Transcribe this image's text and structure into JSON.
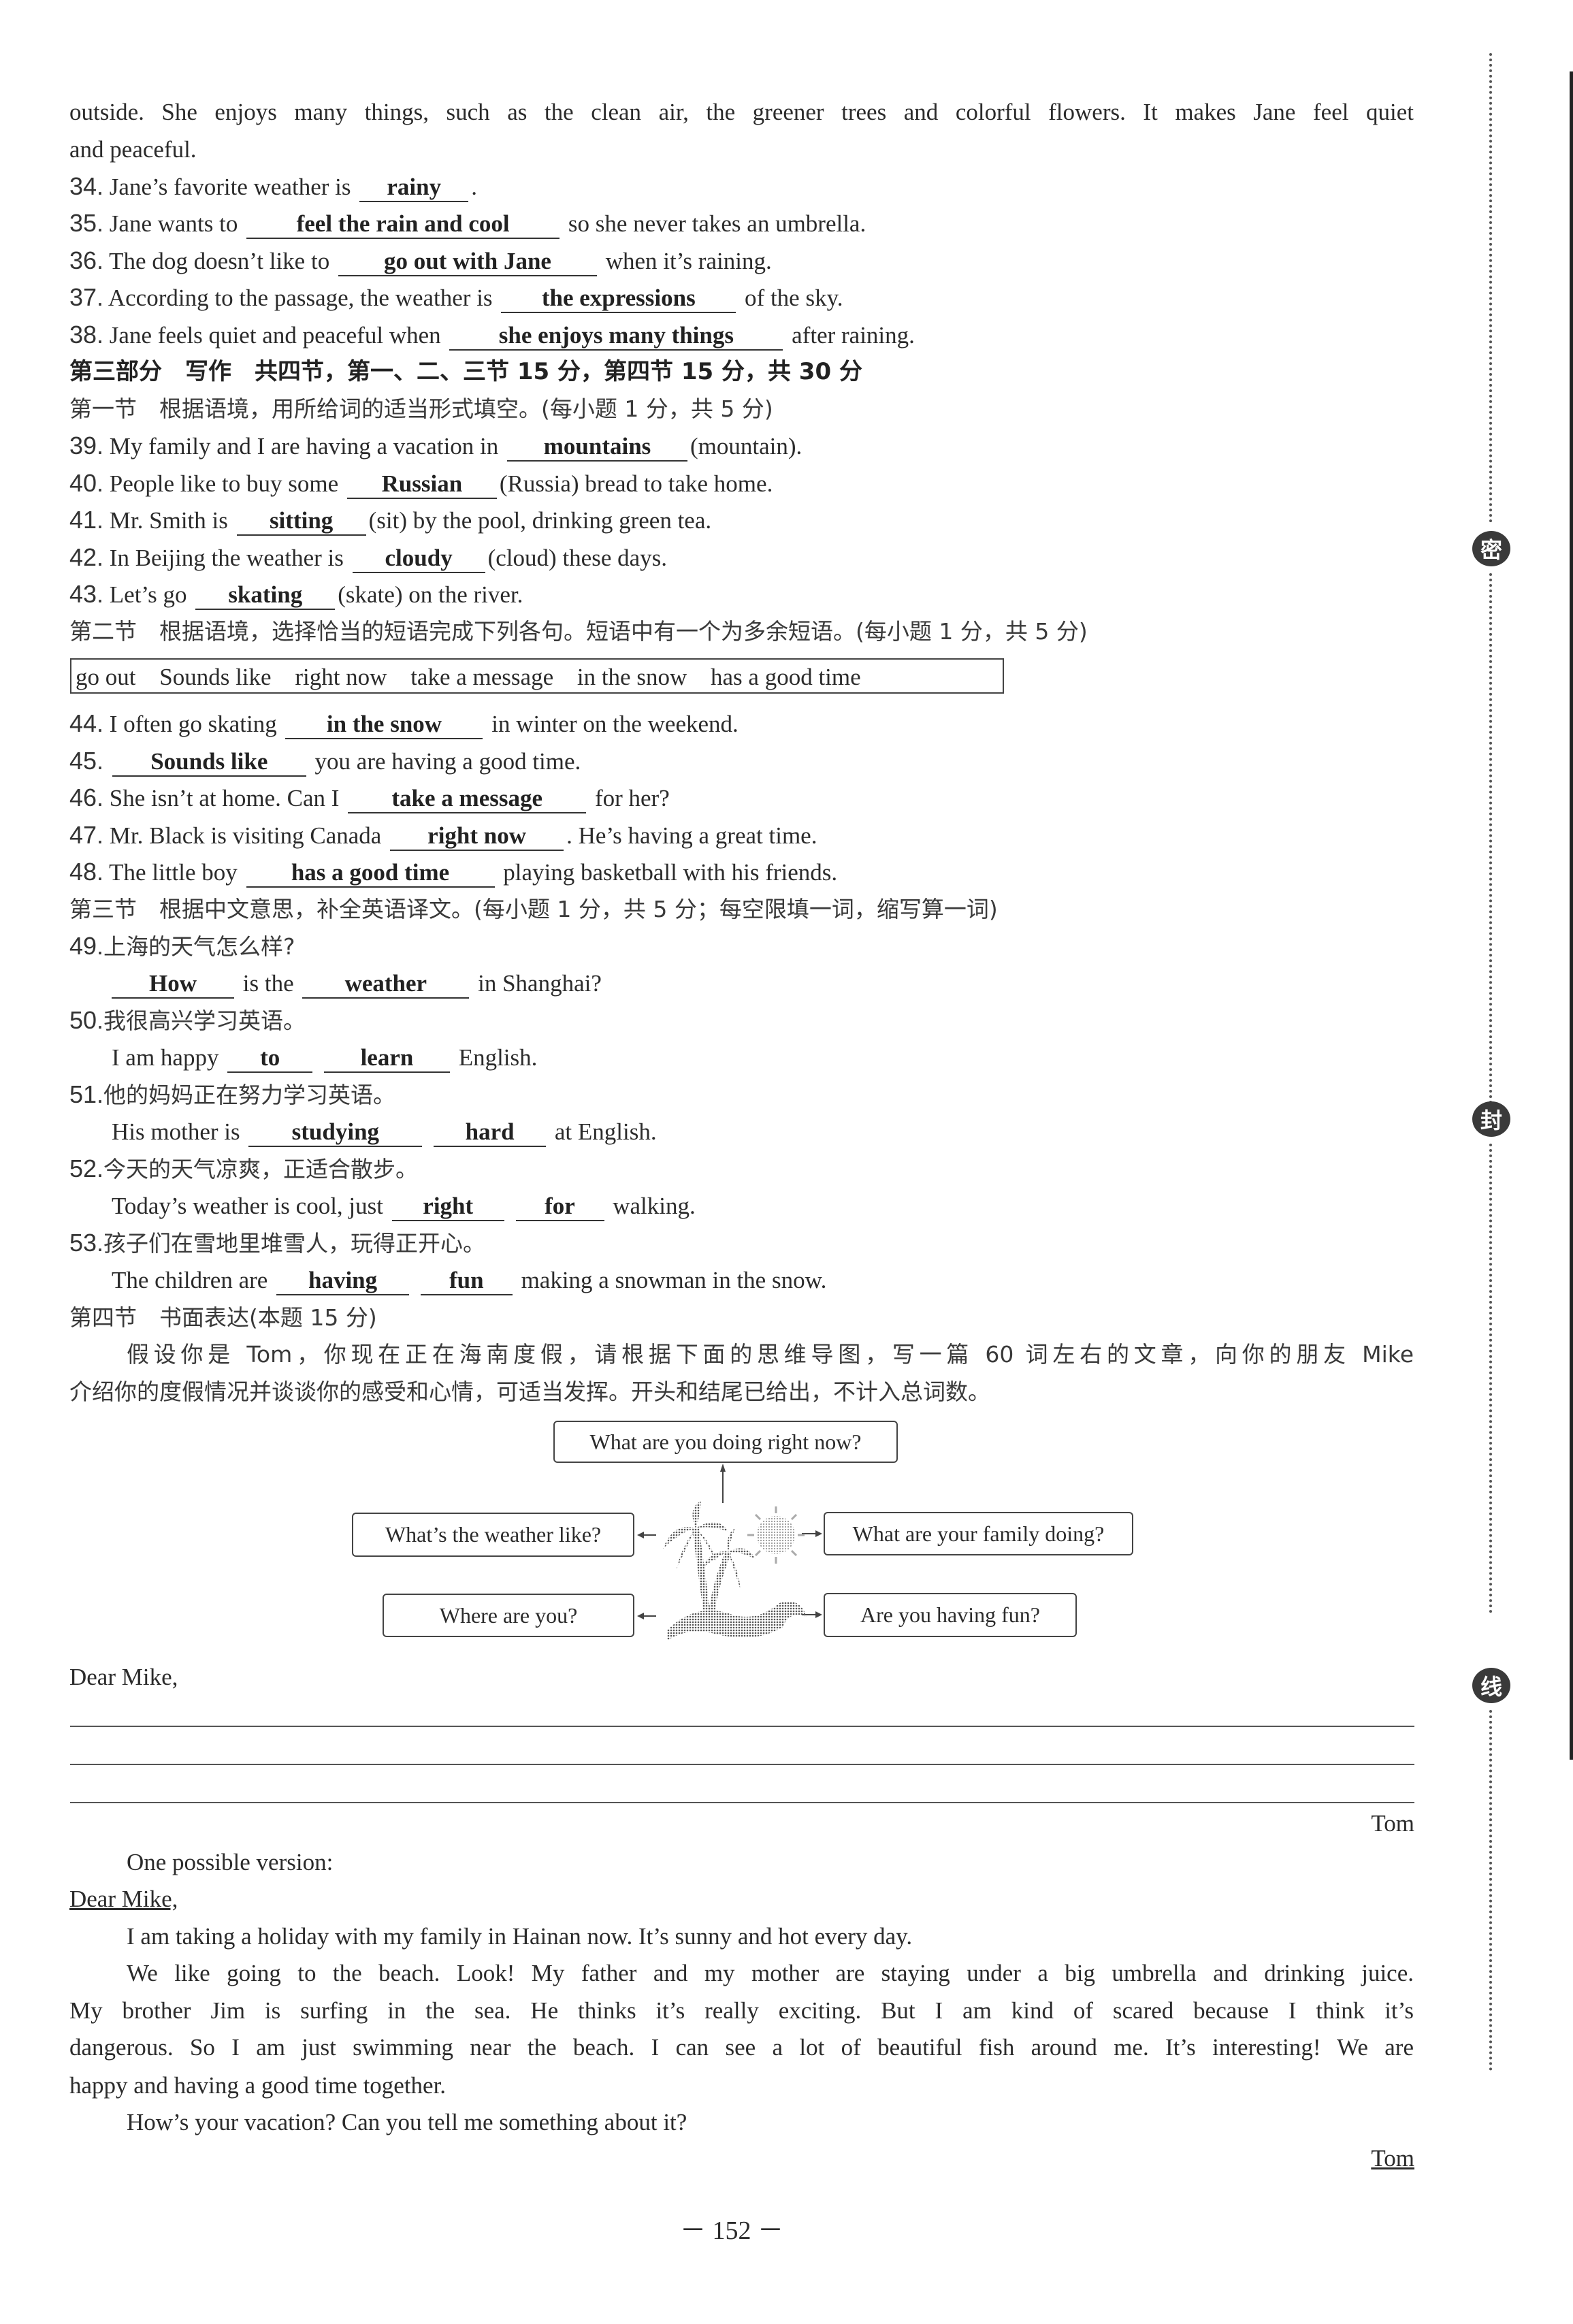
{
  "reading_tail": {
    "line1": "outside. She enjoys many things, such as the clean air, the greener trees and colorful flowers. It makes Jane feel quiet",
    "line2": "and peaceful."
  },
  "part1_answers": [
    {
      "num": "34.",
      "before": "Jane’s favorite weather is",
      "answer": "rainy",
      "after": "."
    },
    {
      "num": "35.",
      "before": "Jane wants to",
      "answer": "feel the rain and cool",
      "after": "so she never takes an umbrella."
    },
    {
      "num": "36.",
      "before": "The dog doesn’t like to",
      "answer": "go out with Jane",
      "after": "when it’s raining."
    },
    {
      "num": "37.",
      "before": "According to the passage, the weather is",
      "answer": "the expressions",
      "after": "of the sky."
    },
    {
      "num": "38.",
      "before": "Jane feels quiet and peaceful when",
      "answer": "she enjoys many things",
      "after": "after raining."
    }
  ],
  "part3_heading": "第三部分　写作　共四节，第一、二、三节 15 分，第四节 15 分，共 30 分",
  "section1": {
    "heading": "第一节　根据语境，用所给词的适当形式填空。(每小题 1 分，共 5 分)",
    "items": [
      {
        "num": "39.",
        "before": "My family and I are having a vacation in",
        "answer": "mountains",
        "after": "(mountain)."
      },
      {
        "num": "40.",
        "before": "People like to buy some",
        "answer": "Russian",
        "after": "(Russia) bread to take home."
      },
      {
        "num": "41.",
        "before": "Mr. Smith is",
        "answer": "sitting",
        "after": "(sit) by the pool, drinking green tea."
      },
      {
        "num": "42.",
        "before": "In Beijing the weather is",
        "answer": "cloudy",
        "after": "(cloud) these days."
      },
      {
        "num": "43.",
        "before": "Let’s go",
        "answer": "skating",
        "after": "(skate) on the river."
      }
    ]
  },
  "section2": {
    "heading": "第二节　根据语境，选择恰当的短语完成下列各句。短语中有一个为多余短语。(每小题 1 分，共 5 分)",
    "phrases": [
      "go out",
      "Sounds like",
      "right now",
      "take a message",
      "in the snow",
      "has a good time"
    ],
    "items": [
      {
        "num": "44.",
        "before": "I often go skating",
        "answer": "in the snow",
        "after": "in winter on the weekend."
      },
      {
        "num": "45.",
        "before": "",
        "answer": "Sounds like",
        "after": "you are having a good time."
      },
      {
        "num": "46.",
        "before": "She isn’t at home. Can I",
        "answer": "take a message",
        "after": "for her?"
      },
      {
        "num": "47.",
        "before": "Mr. Black is visiting Canada",
        "answer": "right now",
        "after": ". He’s having a great time."
      },
      {
        "num": "48.",
        "before": "The little boy",
        "answer": "has a good time",
        "after": "playing basketball with his friends."
      }
    ]
  },
  "section3": {
    "heading": "第三节　根据中文意思，补全英语译文。(每小题 1 分，共 5 分；每空限填一词，缩写算一词)",
    "items": [
      {
        "num": "49.",
        "chinese": "上海的天气怎么样?",
        "parts": [
          "",
          "How",
          "is the",
          "weather",
          "in Shanghai?"
        ]
      },
      {
        "num": "50.",
        "chinese": "我很高兴学习英语。",
        "parts": [
          "I am happy",
          "to",
          "",
          "learn",
          "English."
        ]
      },
      {
        "num": "51.",
        "chinese": "他的妈妈正在努力学习英语。",
        "parts": [
          "His mother is",
          "studying",
          "",
          "hard",
          "at English."
        ]
      },
      {
        "num": "52.",
        "chinese": "今天的天气凉爽，正适合散步。",
        "parts": [
          "Today’s weather is cool, just",
          "right",
          "",
          "for",
          "walking."
        ]
      },
      {
        "num": "53.",
        "chinese": "孩子们在雪地里堆雪人，玩得正开心。",
        "parts": [
          "The children are",
          "having",
          "",
          "fun",
          "making a snowman in the snow."
        ]
      }
    ]
  },
  "section4": {
    "heading": "第四节　书面表达(本题 15 分)",
    "prompt_line1": "假设你是 Tom，你现在正在海南度假，请根据下面的思维导图，写一篇 60 词左右的文章，向你的朋友 Mike",
    "prompt_line2": "介绍你的度假情况并谈谈你的感受和心情，可适当发挥。开头和结尾已给出，不计入总词数。",
    "mind_map": {
      "top": "What are you doing right now?",
      "left_top": "What’s the weather like?",
      "left_bottom": "Where are you?",
      "right_top": "What are your family doing?",
      "right_bottom": "Are you having fun?"
    },
    "greeting": "Dear Mike,",
    "signature": "Tom"
  },
  "sample": {
    "label": "One possible version:",
    "greeting": "Dear Mike,",
    "p1": "I am taking a holiday with my family in Hainan now. It’s sunny and hot every day.",
    "p2_line1": "We like going to the beach. Look! My father and my mother are staying under a big umbrella and drinking juice.",
    "p2_line2": "My brother Jim is surfing in the sea. He thinks it’s really exciting. But I am kind of scared because I think it’s",
    "p2_line3": "dangerous. So I am just swimming near the beach. I can see a lot of beautiful fish around me. It’s interesting! We are",
    "p2_line4": "happy and having a good time together.",
    "p3": "How’s your vacation? Can you tell me something about it?",
    "signature": "Tom"
  },
  "margin_seals": [
    "密",
    "封",
    "线"
  ],
  "page_number": "－ 152 －"
}
